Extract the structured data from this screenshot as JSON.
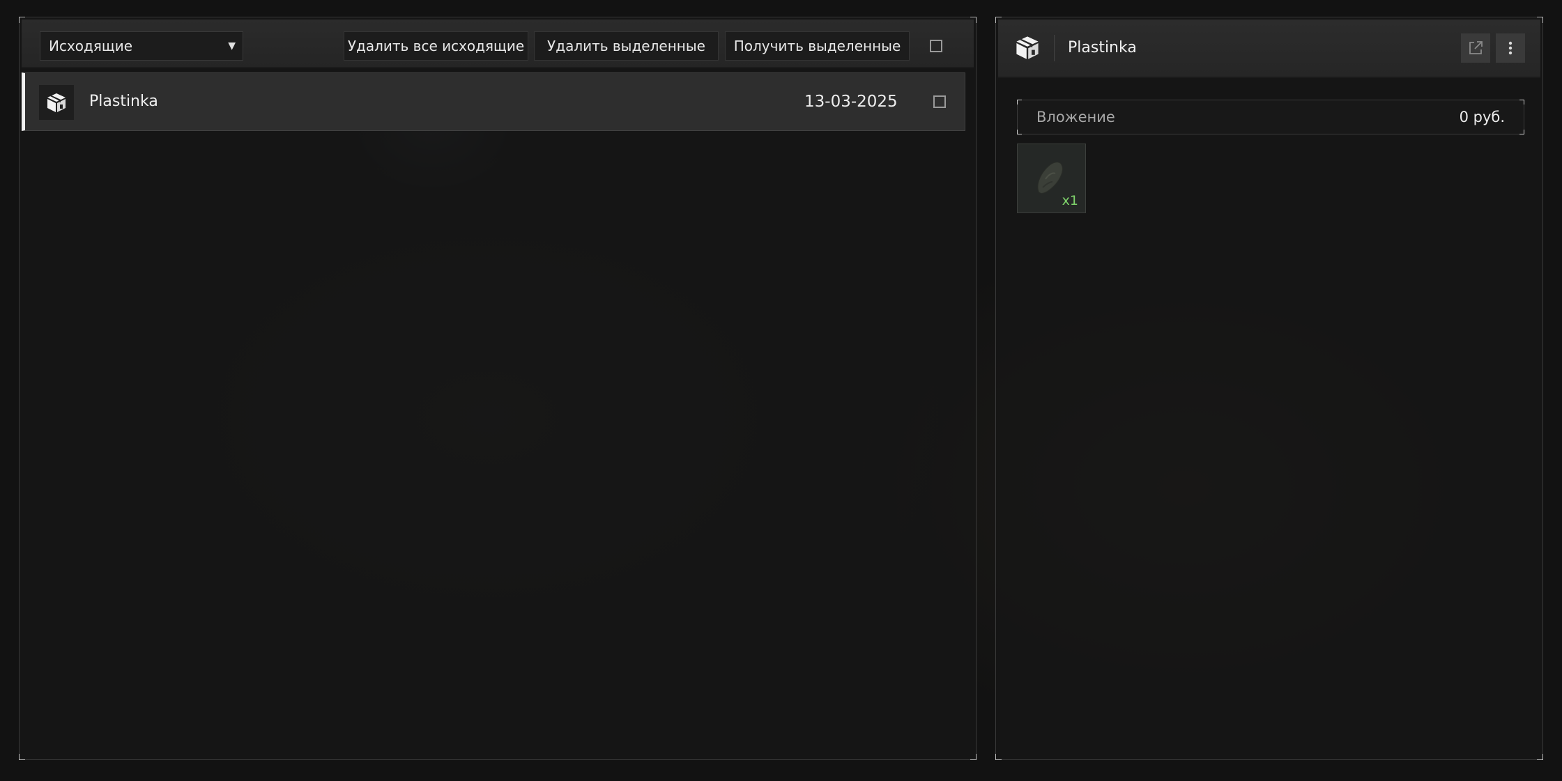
{
  "toolbar": {
    "filter_selected": "Исходящие",
    "delete_all_label": "Удалить все исходящие",
    "delete_selected_label": "Удалить выделенные",
    "get_selected_label": "Получить выделенные"
  },
  "mail_list": [
    {
      "title": "Plastinka",
      "date": "13-03-2025"
    }
  ],
  "details": {
    "title": "Plastinka",
    "attachment_label": "Вложение",
    "attachment_value": "0 руб.",
    "items": [
      {
        "icon": "item-plate-icon",
        "quantity": "x1"
      }
    ]
  },
  "colors": {
    "accent": "#f0f0f0",
    "quantity_green": "#7fd36b",
    "panel_bg": "#161616"
  }
}
